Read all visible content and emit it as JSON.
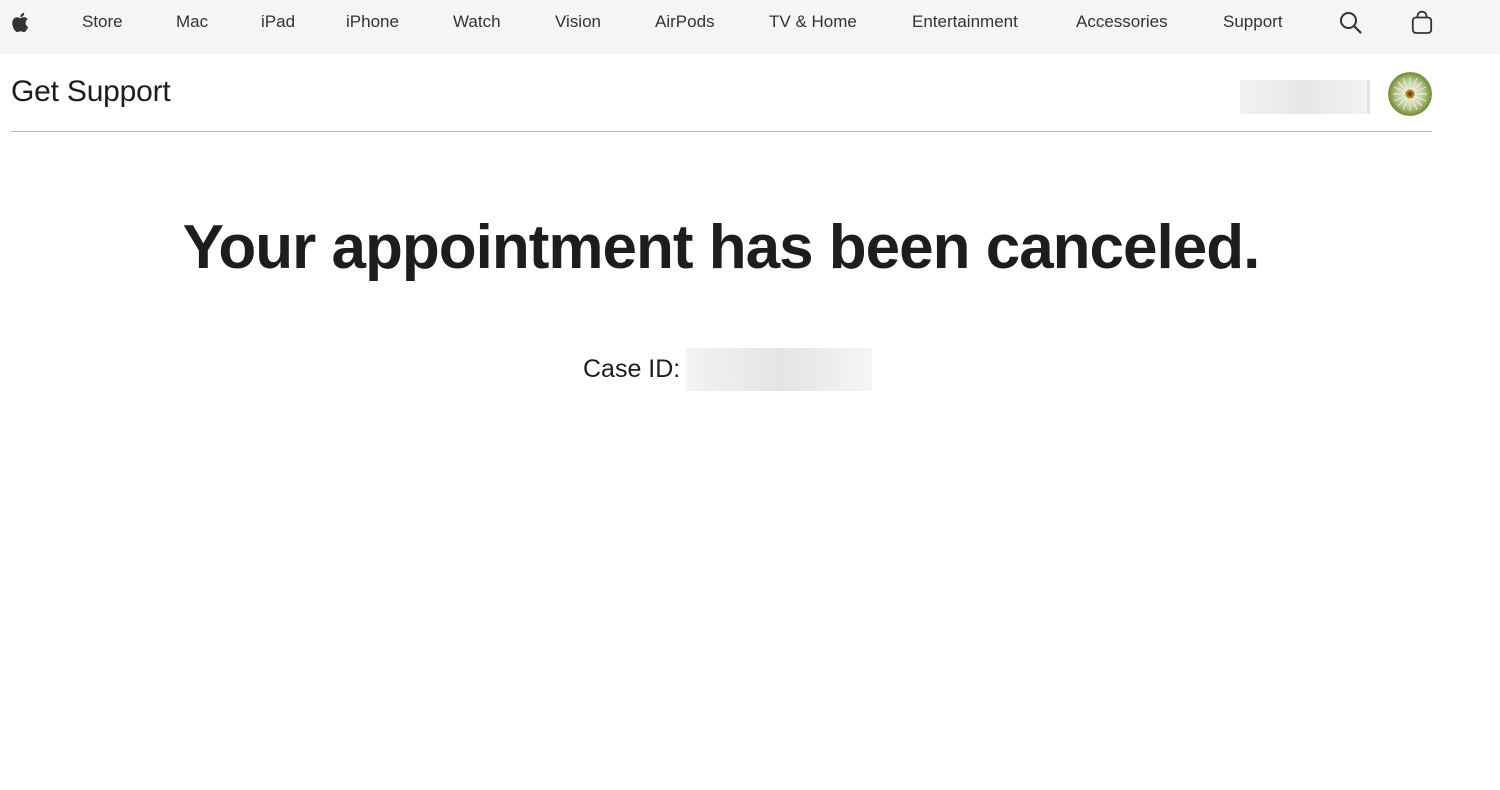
{
  "globalnav": {
    "apple_logo": "apple-logo-icon",
    "items": [
      {
        "label": "Store"
      },
      {
        "label": "Mac"
      },
      {
        "label": "iPad"
      },
      {
        "label": "iPhone"
      },
      {
        "label": "Watch"
      },
      {
        "label": "Vision"
      },
      {
        "label": "AirPods"
      },
      {
        "label": "TV & Home"
      },
      {
        "label": "Entertainment"
      },
      {
        "label": "Accessories"
      },
      {
        "label": "Support"
      }
    ],
    "search_icon": "search-icon",
    "bag_icon": "shopping-bag-icon"
  },
  "localnav": {
    "title": "Get Support",
    "avatar_icon": "dandelion-avatar"
  },
  "main": {
    "headline": "Your appointment has been canceled.",
    "case_label": "Case ID:"
  },
  "colors": {
    "nav_background": "#f5f5f7",
    "text": "#1d1d1f",
    "divider": "#b9b9bd"
  }
}
